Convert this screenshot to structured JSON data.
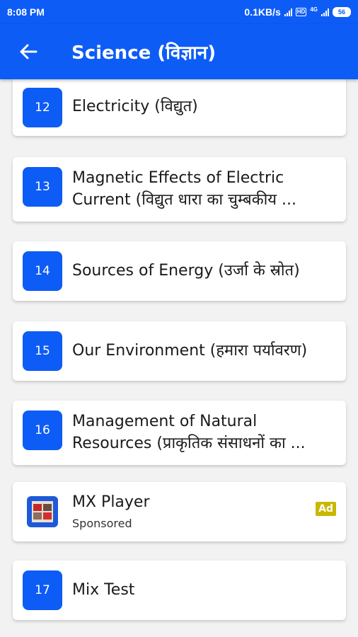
{
  "status_bar": {
    "time": "8:08 PM",
    "speed": "0.1KB/s",
    "network": "4G",
    "battery": "56"
  },
  "app_bar": {
    "title": "Science (विज्ञान)",
    "back_icon": "arrow-left-icon"
  },
  "chapters": [
    {
      "number": "12",
      "line1": "Electricity (विद्युत)",
      "line2": ""
    },
    {
      "number": "13",
      "line1": "Magnetic Effects of Electric",
      "line2": "Current (विद्युत धारा का चुम्बकीय ..."
    },
    {
      "number": "14",
      "line1": "Sources of Energy (उर्जा के स्रोत)",
      "line2": ""
    },
    {
      "number": "15",
      "line1": "Our Environment (हमारा पर्यावरण)",
      "line2": ""
    },
    {
      "number": "16",
      "line1": "Management of Natural",
      "line2": "Resources (प्राकृतिक संसाधनों का ..."
    }
  ],
  "ad": {
    "title": "MX Player",
    "subtitle": "Sponsored",
    "badge": "Ad"
  },
  "mix_test": {
    "number": "17",
    "label": "Mix Test"
  },
  "colors": {
    "primary": "#0d5cf6",
    "background": "#f2f2f2",
    "ad_badge": "#c8b800"
  }
}
